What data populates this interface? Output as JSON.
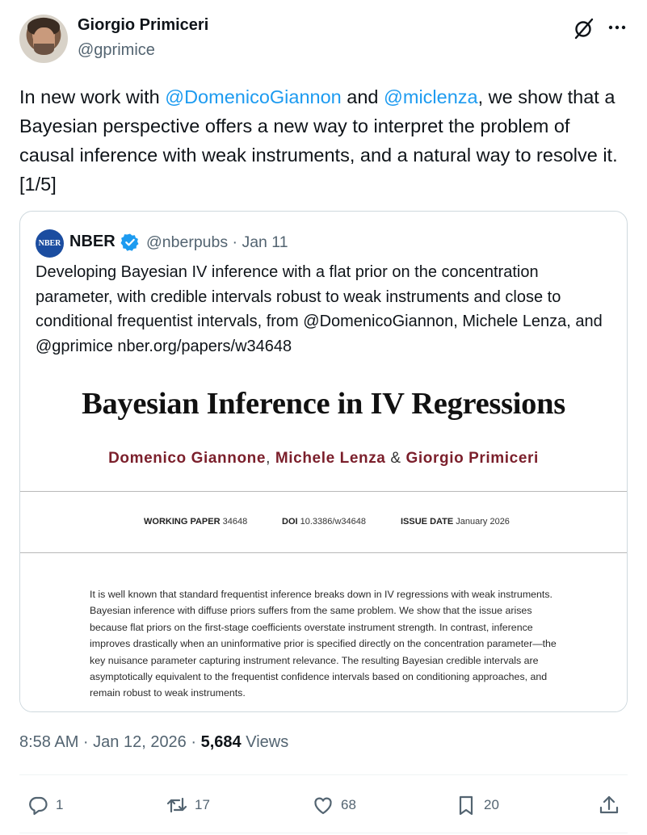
{
  "author": {
    "name": "Giorgio Primiceri",
    "handle": "@gprimice"
  },
  "tweet": {
    "part1": "In new work with ",
    "mention1": "@DomenicoGiannon",
    "part2": " and ",
    "mention2": "@miclenza",
    "part3": ", we show that a Bayesian perspective offers a new way to interpret the problem of causal inference with weak instruments, and a natural way to resolve it. [1/5]"
  },
  "quote": {
    "logo_text": "NBER",
    "name": "NBER",
    "meta": "@nberpubs · Jan 11",
    "text": "Developing Bayesian IV inference with a flat prior on the concentration parameter, with credible intervals robust to weak instruments and close to conditional frequentist intervals, from @DomenicoGiannon, Michele Lenza, and @gprimice nber.org/papers/w34648"
  },
  "paper": {
    "title": "Bayesian Inference in IV Regressions",
    "author1": "Domenico Giannone",
    "sep1": ",",
    "author2": "Michele Lenza",
    "sep2": "&",
    "author3": "Giorgio Primiceri",
    "wp_label": "WORKING PAPER",
    "wp_value": "34648",
    "doi_label": "DOI",
    "doi_value": "10.3386/w34648",
    "date_label": "ISSUE DATE",
    "date_value": "January 2026",
    "abstract": "It is well known that standard frequentist inference breaks down in IV regressions with weak instruments. Bayesian inference with diffuse priors suffers from the same problem. We show that the issue arises because flat priors on the first-stage coefficients overstate instrument strength. In contrast, inference improves drastically when an uninformative prior is specified directly on the concentration parameter—the key nuisance parameter capturing instrument relevance. The resulting Bayesian credible intervals are asymptotically equivalent to the frequentist confidence intervals based on conditioning approaches, and remain robust to weak instruments."
  },
  "meta": {
    "time": "8:58 AM · Jan 12, 2026 · ",
    "views_count": "5,684",
    "views_label": " Views"
  },
  "actions": {
    "replies": "1",
    "reposts": "17",
    "likes": "68",
    "bookmarks": "20"
  },
  "colors": {
    "accent": "#1d9bf0",
    "secondary_text": "#536471",
    "paper_author": "#7b1f2b",
    "nber_logo": "#1b4da0"
  },
  "icons": [
    "grok-icon",
    "more-icon",
    "verified-badge-icon",
    "reply-icon",
    "repost-icon",
    "like-icon",
    "bookmark-icon",
    "share-icon"
  ]
}
